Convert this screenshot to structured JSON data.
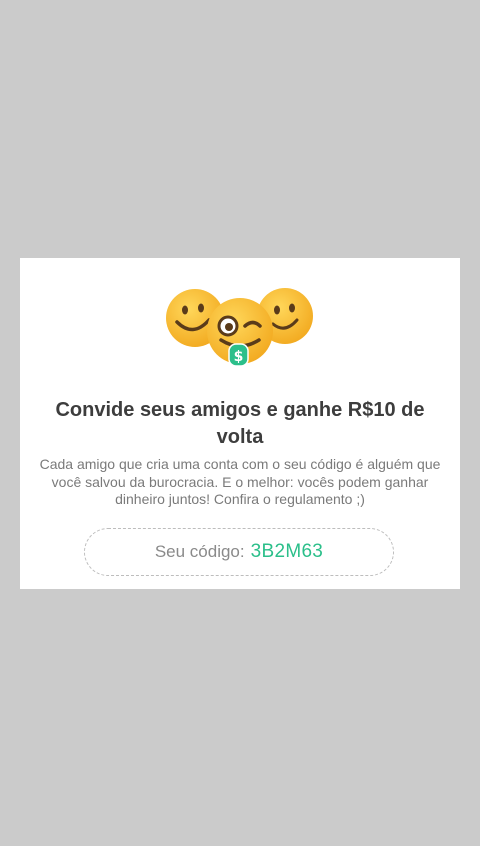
{
  "invite_dialog": {
    "title": "Convide seus amigos e ganhe R$10 de volta",
    "description": "Cada amigo que cria uma conta com o seu código é alguém que você salvou da burocracia. E o melhor: vocês podem ganhar dinheiro juntos! Confira o regulamento ;)",
    "code_label": "Seu código:",
    "code_value": "3B2M63",
    "illustration_icon": "smiling-emojis-with-money-tongue-icon",
    "money_symbol": "$"
  },
  "colors": {
    "overlay": "#cbcbcb",
    "dialog_background": "#ffffff",
    "title": "#3d3d3d",
    "description": "#7a7a7a",
    "code_accent": "#2bbf8a",
    "emoji_yellow": "#f5b82e",
    "dashed_border": "#bdbdbd"
  }
}
